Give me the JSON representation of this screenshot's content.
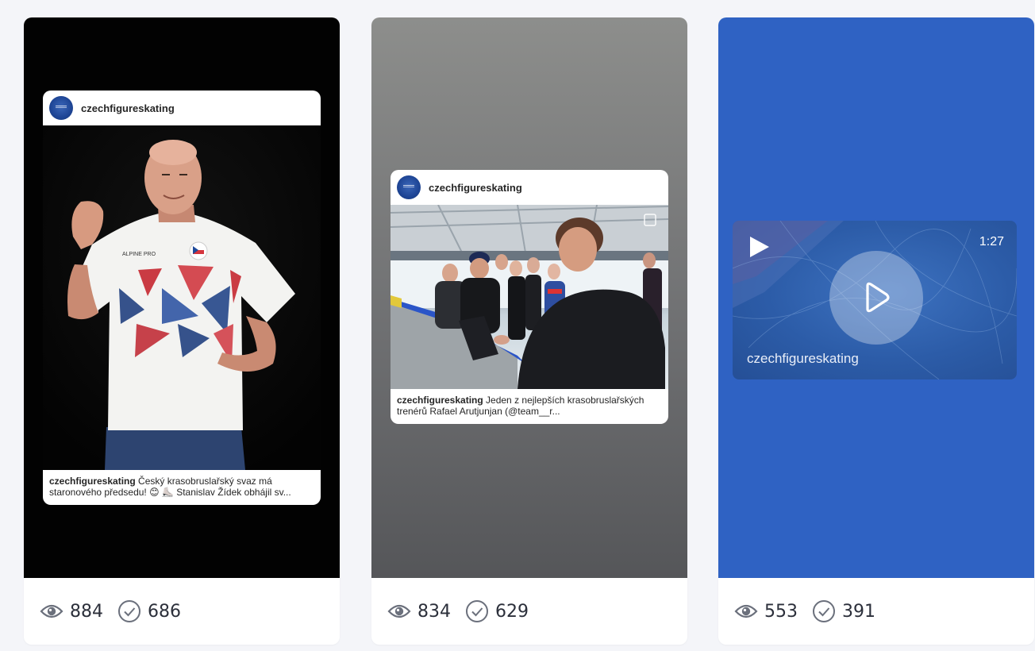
{
  "colors": {
    "page_bg": "#f4f5f9",
    "card_bg": "#ffffff",
    "video_blue": "#2f62c3",
    "stat_text": "#2b2f3a"
  },
  "cards": [
    {
      "post": {
        "username": "czechfigureskating",
        "caption_user": "czechfigureskating",
        "caption_text": " Český krasobruslařský svaz má staronového předsedu! 😊 ⛸️ Stanislav Žídek obhájil sv..."
      },
      "stats": {
        "views": "884",
        "reach": "686"
      }
    },
    {
      "post": {
        "username": "czechfigureskating",
        "caption_user": "czechfigureskating",
        "caption_text": " Jeden z nejlepších krasobruslařských trenérů Rafael Arutjunjan (@team__r..."
      },
      "stats": {
        "views": "834",
        "reach": "629"
      }
    },
    {
      "video": {
        "duration": "1:27",
        "username": "czechfigureskating",
        "side_left": "p",
        "side_right": "."
      },
      "stats": {
        "views": "553",
        "reach": "391"
      }
    }
  ],
  "icons": {
    "views": "eye-icon",
    "reach": "check-circle-icon",
    "video_play": "play-icon"
  }
}
